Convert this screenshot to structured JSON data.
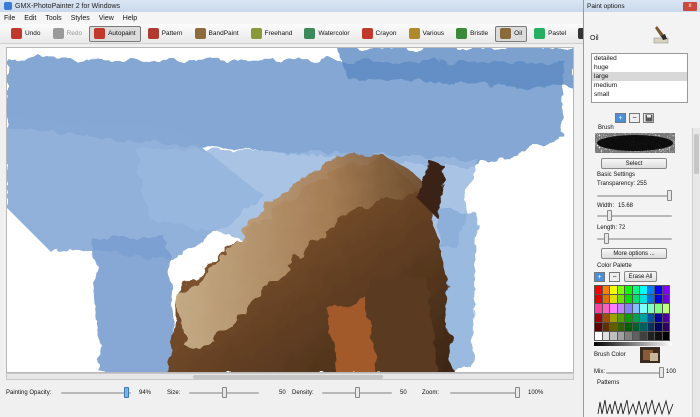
{
  "window": {
    "title": "GMX-PhotoPainter 2 for Windows"
  },
  "menu": [
    "File",
    "Edit",
    "Tools",
    "Styles",
    "View",
    "Help"
  ],
  "toolbar": [
    {
      "label": "Undo",
      "icon": "undo-arrow-icon",
      "color": "#c0392b",
      "state": "normal"
    },
    {
      "label": "Redo",
      "icon": "redo-arrow-icon",
      "color": "#9a9a9a",
      "state": "disabled"
    },
    {
      "label": "Autopaint",
      "icon": "autopaint-icon",
      "color": "#c0392b",
      "state": "active"
    },
    {
      "label": "Pattern",
      "icon": "pattern-icon",
      "color": "#b03a2e",
      "state": "normal"
    },
    {
      "label": "BandPaint",
      "icon": "bandpaint-icon",
      "color": "#8e6b3a",
      "state": "normal"
    },
    {
      "label": "Freehand",
      "icon": "freehand-icon",
      "color": "#8a9a3a",
      "state": "normal"
    },
    {
      "label": "Watercolor",
      "icon": "watercolor-icon",
      "color": "#3a8a5a",
      "state": "normal"
    },
    {
      "label": "Crayon",
      "icon": "crayon-icon",
      "color": "#c0392b",
      "state": "normal"
    },
    {
      "label": "Various",
      "icon": "various-icon",
      "color": "#b08a2a",
      "state": "normal"
    },
    {
      "label": "Bristle",
      "icon": "bristle-icon",
      "color": "#3a8a3a",
      "state": "normal"
    },
    {
      "label": "Oil",
      "icon": "oil-brush-icon",
      "color": "#8a6a3a",
      "state": "active"
    },
    {
      "label": "Pastel",
      "icon": "pastel-icon",
      "color": "#27ae60",
      "state": "normal"
    },
    {
      "label": "PenInk",
      "icon": "penink-icon",
      "color": "#333333",
      "state": "normal"
    }
  ],
  "bottom": {
    "painting_opacity": {
      "label": "Painting Opacity:",
      "value": "94%",
      "fraction": 0.94
    },
    "size": {
      "label": "Size:",
      "value": "50",
      "fraction": 0.5
    },
    "density": {
      "label": "Density:",
      "value": "50",
      "fraction": 0.5
    },
    "zoom": {
      "label": "Zoom:",
      "value": "100%",
      "fraction": 1.0
    }
  },
  "panel": {
    "title": "Paint options",
    "close": "x",
    "style_name": "Oil",
    "sizes": [
      "detailed",
      "huge",
      "large",
      "medium",
      "small"
    ],
    "selected_size": "large",
    "brush_label": "Brush",
    "select_button": "Select",
    "basic_settings": "Basic Settings",
    "transparency": {
      "label": "Transparency: 255",
      "fraction": 1.0
    },
    "width": {
      "label": "Width:",
      "value": "15.68",
      "fraction": 0.16
    },
    "length": {
      "label": "Length: 72",
      "fraction": 0.12
    },
    "more_options": "More options ...",
    "color_palette": "Color Palette",
    "erase_all": "Erase All",
    "brush_color": "Brush Color",
    "mix": {
      "label": "Mix:",
      "value": "100",
      "fraction": 1.0
    },
    "patterns": "Patterns"
  },
  "colors": {
    "palette_rows": [
      [
        "#ff0000",
        "#ff8000",
        "#ffff00",
        "#80ff00",
        "#00ff00",
        "#00ff80",
        "#00ffff",
        "#0080ff",
        "#0000ff",
        "#8000ff"
      ],
      [
        "#e00000",
        "#e07000",
        "#e0e000",
        "#70e000",
        "#00e000",
        "#00e070",
        "#00e0e0",
        "#0070e0",
        "#0000e0",
        "#7000e0"
      ],
      [
        "#ff40a0",
        "#ff60c0",
        "#ff80ff",
        "#c080ff",
        "#8080ff",
        "#80c0ff",
        "#80ffff",
        "#80ffc0",
        "#80ff80",
        "#c0ff80"
      ],
      [
        "#a00000",
        "#a05000",
        "#a0a000",
        "#50a000",
        "#00a000",
        "#00a050",
        "#00a0a0",
        "#0050a0",
        "#0000a0",
        "#5000a0"
      ],
      [
        "#600000",
        "#603000",
        "#606000",
        "#306000",
        "#006000",
        "#006030",
        "#006060",
        "#003060",
        "#000060",
        "#300060"
      ],
      [
        "#ffffff",
        "#e0e0e0",
        "#c0c0c0",
        "#a0a0a0",
        "#808080",
        "#606060",
        "#404040",
        "#202020",
        "#101010",
        "#000000"
      ]
    ]
  }
}
